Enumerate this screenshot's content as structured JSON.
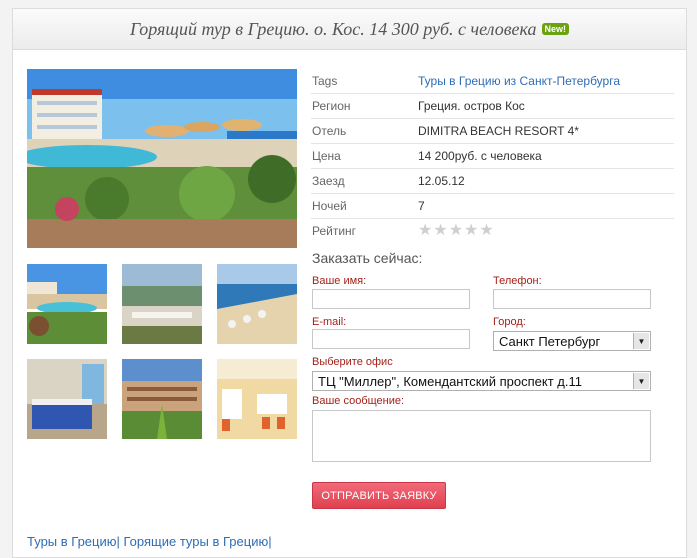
{
  "header": {
    "title": "Горящий тур в Грецию. о. Кос. 14 300 руб. с человека",
    "badge": "New!"
  },
  "details": [
    {
      "key": "Tags",
      "value": "Туры в Грецию из Санкт-Петербурга",
      "is_link": true
    },
    {
      "key": "Регион",
      "value": "Греция. остров Кос"
    },
    {
      "key": "Отель",
      "value": "DIMITRA BEACH RESORT 4*"
    },
    {
      "key": "Цена",
      "value": "14 200руб. с человека"
    },
    {
      "key": "Заезд",
      "value": "12.05.12"
    },
    {
      "key": "Ночей",
      "value": "7"
    },
    {
      "key": "Рейтинг",
      "value": ""
    }
  ],
  "rating": {
    "stars": 0,
    "max": 5
  },
  "form": {
    "title": "Заказать сейчас:",
    "name_label": "Ваше имя:",
    "phone_label": "Телефон:",
    "email_label": "E-mail:",
    "city_label": "Город:",
    "city_value": "Санкт Петербург",
    "office_label": "Выберите офис",
    "office_value": "ТЦ \"Миллер\", Комендантский проспект д.11",
    "message_label": "Ваше сообщение:",
    "submit_label": "ОТПРАВИТЬ ЗАЯВКУ"
  },
  "footer_links": [
    "Туры в Грецию",
    "Горящие туры в Грецию"
  ],
  "colors": {
    "link": "#2f6db5",
    "label_red": "#a5211a",
    "badge": "#6aa30f",
    "button": "#e0404f"
  }
}
